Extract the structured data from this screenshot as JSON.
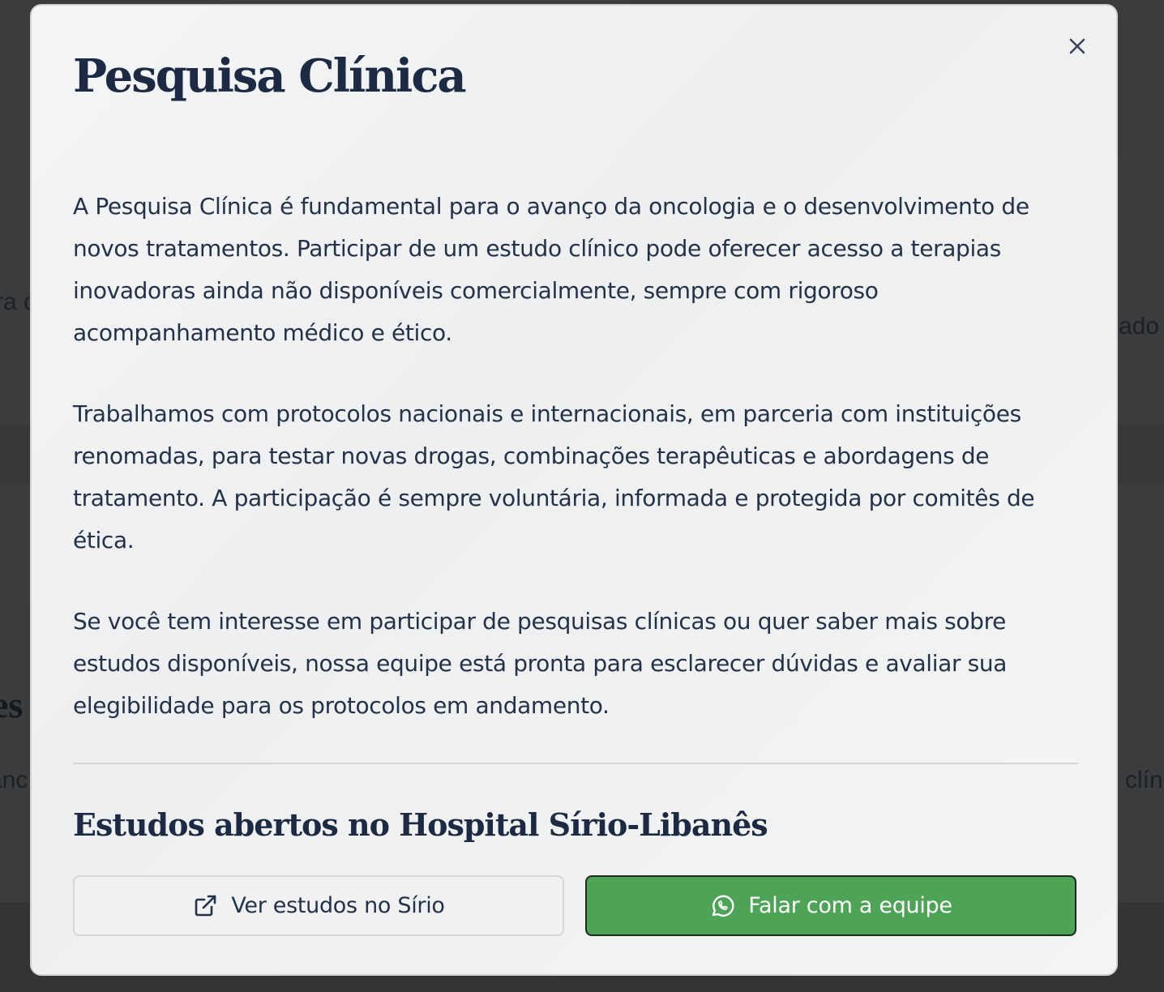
{
  "background": {
    "fragments": [
      "ra c",
      "ado",
      "es",
      "anc",
      "clín"
    ]
  },
  "modal": {
    "title": "Pesquisa Clínica",
    "close_icon": "close-icon",
    "paragraphs": [
      "A Pesquisa Clínica é fundamental para o avanço da oncologia e o desenvolvimento de novos tratamentos. Participar de um estudo clínico pode oferecer acesso a terapias inovadoras ainda não disponíveis comercialmente, sempre com rigoroso acompanhamento médico e ético.",
      "Trabalhamos com protocolos nacionais e internacionais, em parceria com instituições renomadas, para testar novas drogas, combinações terapêuticas e abordagens de tratamento. A participação é sempre voluntária, informada e protegida por comitês de ética.",
      "Se você tem interesse em participar de pesquisas clínicas ou quer saber mais sobre estudos disponíveis, nossa equipe está pronta para esclarecer dúvidas e avaliar sua elegibilidade para os protocolos em andamento."
    ],
    "section_title": "Estudos abertos no Hospital Sírio-Libanês",
    "buttons": {
      "view_studies": {
        "label": "Ver estudos no Sírio",
        "icon": "external-link-icon"
      },
      "contact_team": {
        "label": "Falar com a equipe",
        "icon": "whatsapp-icon"
      }
    }
  },
  "colors": {
    "title": "#1c2a44",
    "body_text": "#233249",
    "primary_button": "#4ea456",
    "overlay": "#3b3c3d"
  }
}
